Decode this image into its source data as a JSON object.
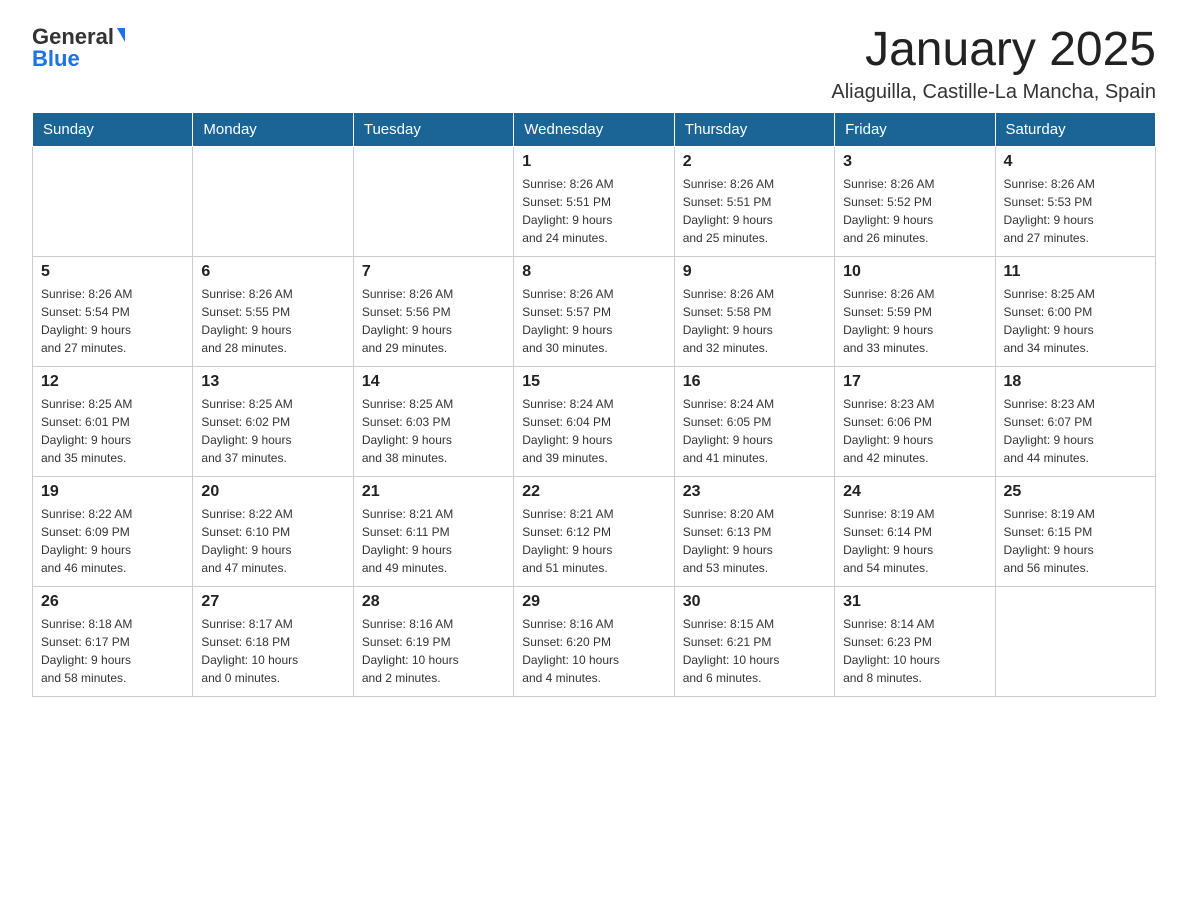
{
  "header": {
    "logo_general": "General",
    "logo_blue": "Blue",
    "month_title": "January 2025",
    "location": "Aliaguilla, Castille-La Mancha, Spain"
  },
  "days_of_week": [
    "Sunday",
    "Monday",
    "Tuesday",
    "Wednesday",
    "Thursday",
    "Friday",
    "Saturday"
  ],
  "weeks": [
    [
      {
        "day": "",
        "info": ""
      },
      {
        "day": "",
        "info": ""
      },
      {
        "day": "",
        "info": ""
      },
      {
        "day": "1",
        "info": "Sunrise: 8:26 AM\nSunset: 5:51 PM\nDaylight: 9 hours\nand 24 minutes."
      },
      {
        "day": "2",
        "info": "Sunrise: 8:26 AM\nSunset: 5:51 PM\nDaylight: 9 hours\nand 25 minutes."
      },
      {
        "day": "3",
        "info": "Sunrise: 8:26 AM\nSunset: 5:52 PM\nDaylight: 9 hours\nand 26 minutes."
      },
      {
        "day": "4",
        "info": "Sunrise: 8:26 AM\nSunset: 5:53 PM\nDaylight: 9 hours\nand 27 minutes."
      }
    ],
    [
      {
        "day": "5",
        "info": "Sunrise: 8:26 AM\nSunset: 5:54 PM\nDaylight: 9 hours\nand 27 minutes."
      },
      {
        "day": "6",
        "info": "Sunrise: 8:26 AM\nSunset: 5:55 PM\nDaylight: 9 hours\nand 28 minutes."
      },
      {
        "day": "7",
        "info": "Sunrise: 8:26 AM\nSunset: 5:56 PM\nDaylight: 9 hours\nand 29 minutes."
      },
      {
        "day": "8",
        "info": "Sunrise: 8:26 AM\nSunset: 5:57 PM\nDaylight: 9 hours\nand 30 minutes."
      },
      {
        "day": "9",
        "info": "Sunrise: 8:26 AM\nSunset: 5:58 PM\nDaylight: 9 hours\nand 32 minutes."
      },
      {
        "day": "10",
        "info": "Sunrise: 8:26 AM\nSunset: 5:59 PM\nDaylight: 9 hours\nand 33 minutes."
      },
      {
        "day": "11",
        "info": "Sunrise: 8:25 AM\nSunset: 6:00 PM\nDaylight: 9 hours\nand 34 minutes."
      }
    ],
    [
      {
        "day": "12",
        "info": "Sunrise: 8:25 AM\nSunset: 6:01 PM\nDaylight: 9 hours\nand 35 minutes."
      },
      {
        "day": "13",
        "info": "Sunrise: 8:25 AM\nSunset: 6:02 PM\nDaylight: 9 hours\nand 37 minutes."
      },
      {
        "day": "14",
        "info": "Sunrise: 8:25 AM\nSunset: 6:03 PM\nDaylight: 9 hours\nand 38 minutes."
      },
      {
        "day": "15",
        "info": "Sunrise: 8:24 AM\nSunset: 6:04 PM\nDaylight: 9 hours\nand 39 minutes."
      },
      {
        "day": "16",
        "info": "Sunrise: 8:24 AM\nSunset: 6:05 PM\nDaylight: 9 hours\nand 41 minutes."
      },
      {
        "day": "17",
        "info": "Sunrise: 8:23 AM\nSunset: 6:06 PM\nDaylight: 9 hours\nand 42 minutes."
      },
      {
        "day": "18",
        "info": "Sunrise: 8:23 AM\nSunset: 6:07 PM\nDaylight: 9 hours\nand 44 minutes."
      }
    ],
    [
      {
        "day": "19",
        "info": "Sunrise: 8:22 AM\nSunset: 6:09 PM\nDaylight: 9 hours\nand 46 minutes."
      },
      {
        "day": "20",
        "info": "Sunrise: 8:22 AM\nSunset: 6:10 PM\nDaylight: 9 hours\nand 47 minutes."
      },
      {
        "day": "21",
        "info": "Sunrise: 8:21 AM\nSunset: 6:11 PM\nDaylight: 9 hours\nand 49 minutes."
      },
      {
        "day": "22",
        "info": "Sunrise: 8:21 AM\nSunset: 6:12 PM\nDaylight: 9 hours\nand 51 minutes."
      },
      {
        "day": "23",
        "info": "Sunrise: 8:20 AM\nSunset: 6:13 PM\nDaylight: 9 hours\nand 53 minutes."
      },
      {
        "day": "24",
        "info": "Sunrise: 8:19 AM\nSunset: 6:14 PM\nDaylight: 9 hours\nand 54 minutes."
      },
      {
        "day": "25",
        "info": "Sunrise: 8:19 AM\nSunset: 6:15 PM\nDaylight: 9 hours\nand 56 minutes."
      }
    ],
    [
      {
        "day": "26",
        "info": "Sunrise: 8:18 AM\nSunset: 6:17 PM\nDaylight: 9 hours\nand 58 minutes."
      },
      {
        "day": "27",
        "info": "Sunrise: 8:17 AM\nSunset: 6:18 PM\nDaylight: 10 hours\nand 0 minutes."
      },
      {
        "day": "28",
        "info": "Sunrise: 8:16 AM\nSunset: 6:19 PM\nDaylight: 10 hours\nand 2 minutes."
      },
      {
        "day": "29",
        "info": "Sunrise: 8:16 AM\nSunset: 6:20 PM\nDaylight: 10 hours\nand 4 minutes."
      },
      {
        "day": "30",
        "info": "Sunrise: 8:15 AM\nSunset: 6:21 PM\nDaylight: 10 hours\nand 6 minutes."
      },
      {
        "day": "31",
        "info": "Sunrise: 8:14 AM\nSunset: 6:23 PM\nDaylight: 10 hours\nand 8 minutes."
      },
      {
        "day": "",
        "info": ""
      }
    ]
  ]
}
